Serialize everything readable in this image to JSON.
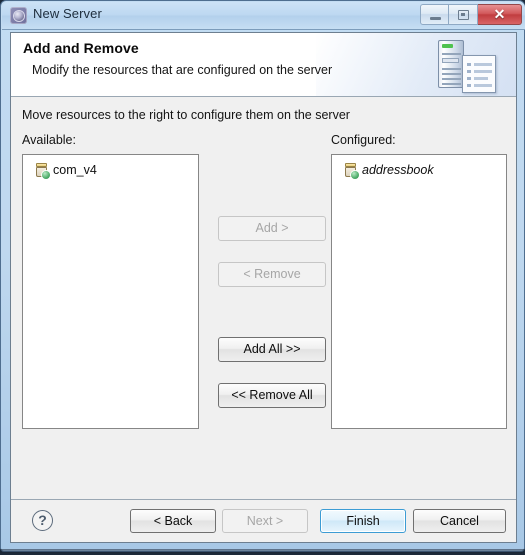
{
  "window": {
    "title": "New Server",
    "icon": "server-gear-icon",
    "controls": {
      "minimize": "minimize-icon",
      "maximize": "maximize-icon",
      "close_glyph": "✕"
    }
  },
  "header": {
    "title": "Add and Remove",
    "subtitle": "Modify the resources that are configured on the server",
    "graphic": "server-and-document-icon"
  },
  "main": {
    "instruction": "Move resources to the right to configure them on the server",
    "available": {
      "label": "Available:",
      "items": [
        {
          "name": "com_v4",
          "icon": "archive-jar-icon",
          "italic": false
        }
      ]
    },
    "configured": {
      "label": "Configured:",
      "items": [
        {
          "name": "addressbook",
          "icon": "archive-jar-icon",
          "italic": true
        }
      ]
    },
    "transfer_buttons": [
      {
        "label": "Add >",
        "enabled": false
      },
      {
        "label": "< Remove",
        "enabled": false
      },
      {
        "label": "Add All >>",
        "enabled": true
      },
      {
        "label": "<< Remove All",
        "enabled": true
      }
    ]
  },
  "footer": {
    "help": "?",
    "buttons": [
      {
        "label": "< Back",
        "enabled": true,
        "default": false
      },
      {
        "label": "Next >",
        "enabled": false,
        "default": false
      },
      {
        "label": "Finish",
        "enabled": true,
        "default": true
      },
      {
        "label": "Cancel",
        "enabled": true,
        "default": false
      }
    ]
  },
  "colors": {
    "titlebar": "#bdd8f1",
    "dialog_bg": "#f0f0f0",
    "header_bg": "#ffffff",
    "default_button_border": "#3c9cd4",
    "close_button": "#c13d3f",
    "badge_green": "#4fae6b"
  }
}
